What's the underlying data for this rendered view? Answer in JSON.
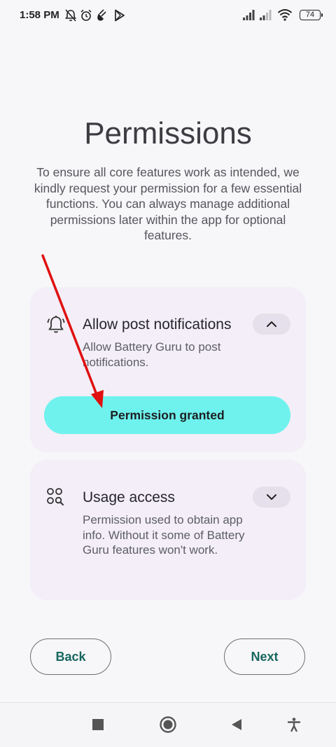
{
  "status_bar": {
    "time": "1:58 PM",
    "battery_level": "74",
    "left_icons": [
      "notifications-off-icon",
      "alarm-icon",
      "charging-plug-icon",
      "play-store-icon"
    ],
    "right_icons": [
      "signal-bars-icon",
      "signal-bars-icon",
      "wifi-icon",
      "battery-icon"
    ]
  },
  "page": {
    "title": "Permissions",
    "intro": "To ensure all core features work as intended, we kindly request your permission for a few essential functions. You can always manage additional permissions later within the app for optional features."
  },
  "permissions": [
    {
      "icon": "bell-icon",
      "title": "Allow post notifications",
      "description": "Allow Battery Guru to post notifications.",
      "expanded": true,
      "toggle_icon": "chevron-up-icon",
      "button_label": "Permission granted"
    },
    {
      "icon": "apps-search-icon",
      "title": "Usage access",
      "description": "Permission used to obtain app info. Without it some of Battery Guru features won't work.",
      "expanded": false,
      "toggle_icon": "chevron-down-icon"
    }
  ],
  "footer": {
    "back_label": "Back",
    "next_label": "Next"
  },
  "system_nav": {
    "icons": [
      "recents-square-icon",
      "home-circle-icon",
      "back-triangle-icon",
      "accessibility-icon"
    ]
  },
  "colors": {
    "background": "#f7f6f8",
    "card": "#f3eef7",
    "grant_button": "#6ff2ee",
    "nav_text": "#17675e",
    "annotation": "#e01010"
  }
}
